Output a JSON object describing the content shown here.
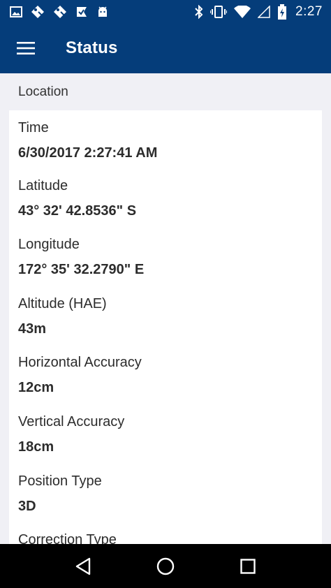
{
  "status_bar": {
    "time": "2:27",
    "notification_icons": [
      "image-icon",
      "tag-icon",
      "tag-icon",
      "check-flag-icon",
      "android-icon"
    ],
    "system_icons": [
      "bluetooth-icon",
      "vibrate-icon",
      "wifi-icon",
      "cell-signal-icon",
      "battery-charging-icon"
    ]
  },
  "app_bar": {
    "title": "Status",
    "menu_icon": "hamburger-menu-icon",
    "background": "#053d7a"
  },
  "section": {
    "header": "Location",
    "fields": [
      {
        "label": "Time",
        "value": "6/30/2017 2:27:41 AM"
      },
      {
        "label": "Latitude",
        "value": "43° 32' 42.8536\" S"
      },
      {
        "label": "Longitude",
        "value": "172° 35' 32.2790\" E"
      },
      {
        "label": "Altitude (HAE)",
        "value": "43m"
      },
      {
        "label": "Horizontal Accuracy",
        "value": "12cm"
      },
      {
        "label": "Vertical Accuracy",
        "value": "18cm"
      },
      {
        "label": "Position Type",
        "value": "3D"
      },
      {
        "label": "Correction Type",
        "value": ""
      }
    ]
  },
  "nav_bar": {
    "buttons": [
      "back-icon",
      "home-icon",
      "recents-icon"
    ]
  }
}
